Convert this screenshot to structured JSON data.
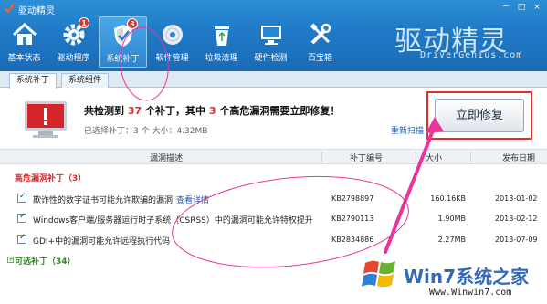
{
  "app": {
    "title": "驱动精灵"
  },
  "window_controls": [
    "－",
    "□",
    "×"
  ],
  "toolbar": {
    "items": [
      {
        "label": "基本状态",
        "icon": "home-icon",
        "badge": ""
      },
      {
        "label": "驱动程序",
        "icon": "gear-icon",
        "badge": "1"
      },
      {
        "label": "系统补丁",
        "icon": "shield-icon",
        "badge": "3",
        "active": true
      },
      {
        "label": "软件管理",
        "icon": "disc-icon",
        "badge": ""
      },
      {
        "label": "垃圾清理",
        "icon": "recycle-bin-icon",
        "badge": ""
      },
      {
        "label": "硬件检测",
        "icon": "monitor-icon",
        "badge": ""
      },
      {
        "label": "百宝箱",
        "icon": "tools-icon",
        "badge": ""
      }
    ]
  },
  "brand": {
    "name": "驱动精灵",
    "site": "DriverGenius.com"
  },
  "tabs": [
    {
      "label": "系统补丁",
      "active": true
    },
    {
      "label": "系统组件",
      "active": false
    }
  ],
  "summary": {
    "text_1": "共检测到",
    "patch_count": "37",
    "text_2": "个补丁，其中",
    "high_risk_count": "3",
    "text_3": "个高危漏洞需要立即修复！",
    "installed": "已选择补丁：3 个    大小：4.32MB",
    "rescan": "重新扫描",
    "fix_button": "立即修复"
  },
  "table": {
    "columns": [
      "漏洞描述",
      "补丁编号",
      "大小",
      "发布日期"
    ],
    "high_group": "高危漏洞补丁（3）",
    "optional_group": "可选补丁（34）",
    "rows": [
      {
        "desc": "欺诈性的数字证书可能允许欺骗的漏洞",
        "link": "查看详情",
        "kb": "KB2798897",
        "size": "160.16KB",
        "date": "2013-01-02"
      },
      {
        "desc": "Windows客户端/服务器运行时子系统（CSRSS）中的漏洞可能允许特权提升",
        "link": "",
        "kb": "KB2790113",
        "size": "1.90MB",
        "date": "2013-02-12"
      },
      {
        "desc": "GDI+中的漏洞可能允许远程执行代码",
        "link": "",
        "kb": "KB2834886",
        "size": "2.27MB",
        "date": "2013-07-09"
      }
    ]
  },
  "watermark": {
    "text": "Win7系统之家",
    "url": "Www.Winwin7.com"
  },
  "colors": {
    "header": "#1f79c6",
    "alert_red": "#e0302a",
    "annotation_pink": "#e8359a",
    "link": "#1c5fb0"
  }
}
